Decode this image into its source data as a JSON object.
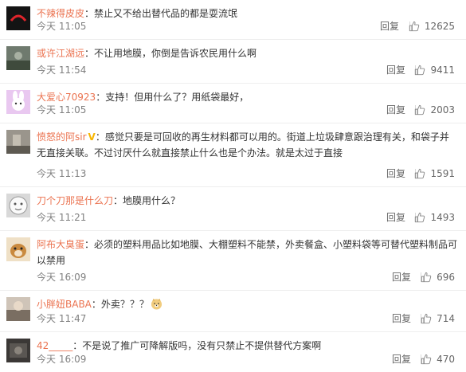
{
  "comments": [
    {
      "user": "不辣得皮皮",
      "verified": false,
      "text": "：禁止又不给出替代品的都是耍流氓",
      "emoji": "",
      "time": "今天 11:05",
      "reply": "回复",
      "likes": "12625"
    },
    {
      "user": "或许江湖远",
      "verified": false,
      "text": "：不让用地膜，你倒是告诉农民用什么啊",
      "emoji": "",
      "time": "今天 11:54",
      "reply": "回复",
      "likes": "9411"
    },
    {
      "user": "大爱心70923",
      "verified": false,
      "text": "：支持！但用什么了？用纸袋最好，",
      "emoji": "",
      "time": "今天 11:05",
      "reply": "回复",
      "likes": "2003"
    },
    {
      "user": "愤怒的阿sir",
      "verified": true,
      "text": "：感觉只要是可回收的再生材料都可以用的。街道上垃圾肆意跟治理有关，和袋子并无直接关联。不过讨厌什么就直接禁止什么也是个办法。就是太过于直接",
      "emoji": "",
      "time": "今天 11:13",
      "reply": "回复",
      "likes": "1591"
    },
    {
      "user": "刀个刀那是什么刀",
      "verified": false,
      "text": "：地膜用什么？",
      "emoji": "",
      "time": "今天 11:21",
      "reply": "回复",
      "likes": "1493"
    },
    {
      "user": "阿布大臭蛋",
      "verified": false,
      "text": "：必须的塑料用品比如地膜、大棚塑料不能禁，外卖餐盒、小塑料袋等可替代塑料制品可以禁用",
      "emoji": "",
      "time": "今天 16:09",
      "reply": "回复",
      "likes": "696"
    },
    {
      "user": "小胖妞BABA",
      "verified": false,
      "text": "：外卖？？？",
      "emoji": "doge-emoji",
      "time": "今天 11:47",
      "reply": "回复",
      "likes": "714"
    },
    {
      "user": "42_____",
      "verified": false,
      "text": "：不是说了推广可降解版吗，没有只禁止不提供替代方案啊",
      "emoji": "",
      "time": "今天 16:09",
      "reply": "回复",
      "likes": "470"
    }
  ],
  "colors": {
    "username": "#eb7350",
    "verified_badge": "#f7b500"
  },
  "icons": {
    "like": "thumbs-up-icon",
    "verified": "verified-v-icon"
  }
}
